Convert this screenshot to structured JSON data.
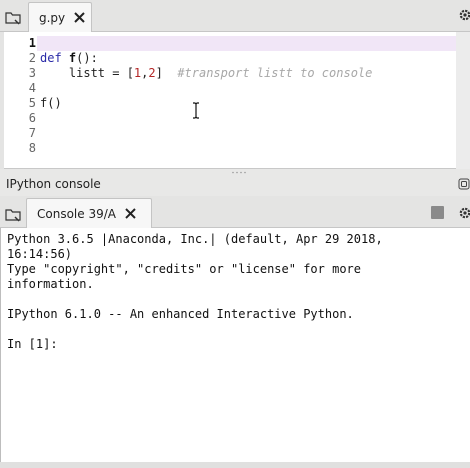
{
  "editor": {
    "tab": {
      "label": "g.py",
      "close_icon": "close-x-icon"
    },
    "line_numbers": [
      "1",
      "2",
      "3",
      "4",
      "5",
      "6",
      "7",
      "8"
    ],
    "code": {
      "line2": {
        "kw": "def",
        "sp": " ",
        "fn": "f",
        "rest": "():"
      },
      "line3": {
        "indent": "    listt = [",
        "n1": "1",
        "comma": ",",
        "n2": "2",
        "close": "]",
        "gap": "  ",
        "comment": "#transport listt to console"
      },
      "line5": {
        "text": "f()"
      }
    }
  },
  "console_pane": {
    "title": "IPython console",
    "tab": {
      "label": "Console 39/A",
      "close_icon": "close-x-icon"
    },
    "output": [
      "Python 3.6.5 |Anaconda, Inc.| (default, Apr 29 2018,",
      "16:14:56)",
      "Type \"copyright\", \"credits\" or \"license\" for more",
      "information.",
      "",
      "IPython 6.1.0 -- An enhanced Interactive Python.",
      ""
    ],
    "prompt": "In [1]:"
  },
  "colors": {
    "current_line_highlight": "#f1e6f7",
    "keyword": "#2a2aa8",
    "number": "#b32626",
    "comment": "#a8a8a8",
    "prompt": "#1f1fa8"
  }
}
